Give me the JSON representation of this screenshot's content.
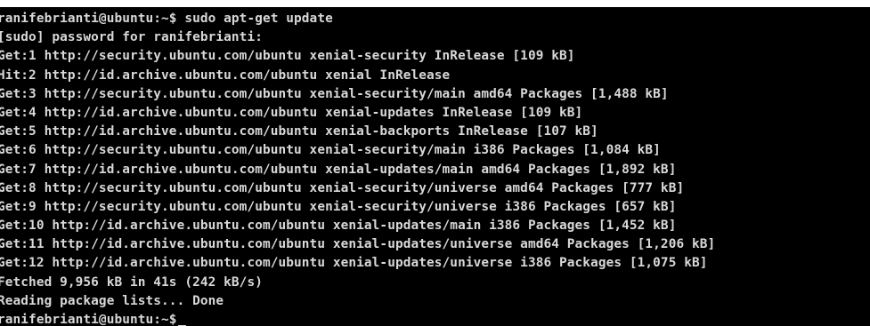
{
  "terminal": {
    "lines": [
      "ranifebrianti@ubuntu:~$ sudo apt-get update",
      "[sudo] password for ranifebrianti:",
      "Get:1 http://security.ubuntu.com/ubuntu xenial-security InRelease [109 kB]",
      "Hit:2 http://id.archive.ubuntu.com/ubuntu xenial InRelease",
      "Get:3 http://security.ubuntu.com/ubuntu xenial-security/main amd64 Packages [1,488 kB]",
      "Get:4 http://id.archive.ubuntu.com/ubuntu xenial-updates InRelease [109 kB]",
      "Get:5 http://id.archive.ubuntu.com/ubuntu xenial-backports InRelease [107 kB]",
      "Get:6 http://security.ubuntu.com/ubuntu xenial-security/main i386 Packages [1,084 kB]",
      "Get:7 http://id.archive.ubuntu.com/ubuntu xenial-updates/main amd64 Packages [1,892 kB]",
      "Get:8 http://security.ubuntu.com/ubuntu xenial-security/universe amd64 Packages [777 kB]",
      "Get:9 http://security.ubuntu.com/ubuntu xenial-security/universe i386 Packages [657 kB]",
      "Get:10 http://id.archive.ubuntu.com/ubuntu xenial-updates/main i386 Packages [1,452 kB]",
      "Get:11 http://id.archive.ubuntu.com/ubuntu xenial-updates/universe amd64 Packages [1,206 kB]",
      "Get:12 http://id.archive.ubuntu.com/ubuntu xenial-updates/universe i386 Packages [1,075 kB]",
      "Fetched 9,956 kB in 41s (242 kB/s)",
      "Reading package lists... Done",
      "ranifebrianti@ubuntu:~$"
    ],
    "colors": {
      "background": "#000000",
      "foreground": "#d8d8d8"
    }
  }
}
